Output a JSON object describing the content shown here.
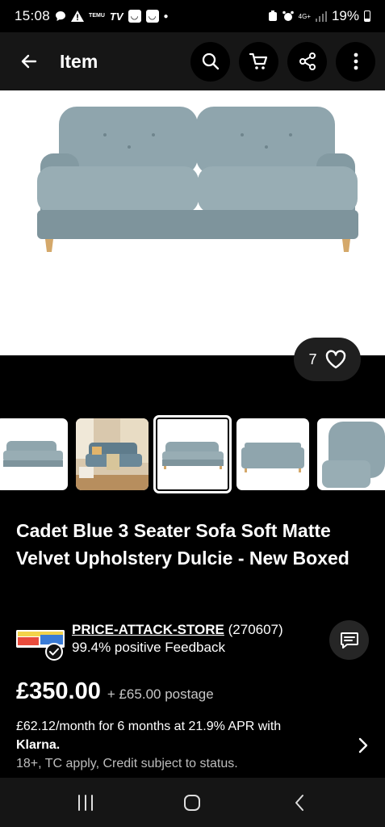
{
  "status_bar": {
    "time": "15:08",
    "temu_label": "TEMU",
    "battery_percent": "19%",
    "network_label": "4G+"
  },
  "app_bar": {
    "title": "Item"
  },
  "hero": {
    "like_count": "7"
  },
  "thumbnails": {
    "count_visible": 5,
    "selected_index": 2
  },
  "listing": {
    "title": "Cadet Blue 3 Seater Sofa Soft Matte Velvet Upholstery Dulcie - New Boxed"
  },
  "seller": {
    "name": "PRICE-ATTACK-STORE",
    "feedback_count": "(270607)",
    "feedback": "99.4% positive Feedback"
  },
  "price": {
    "amount": "£350.00",
    "postage": "+ £65.00 postage"
  },
  "klarna": {
    "line": "£62.12/month for 6 months at 21.9% APR with",
    "brand": "Klarna.",
    "note": "18+, TC apply, Credit subject to status."
  },
  "colors": {
    "sofa": "#8fa5ad",
    "background": "#000000",
    "app_bar": "#161616"
  }
}
